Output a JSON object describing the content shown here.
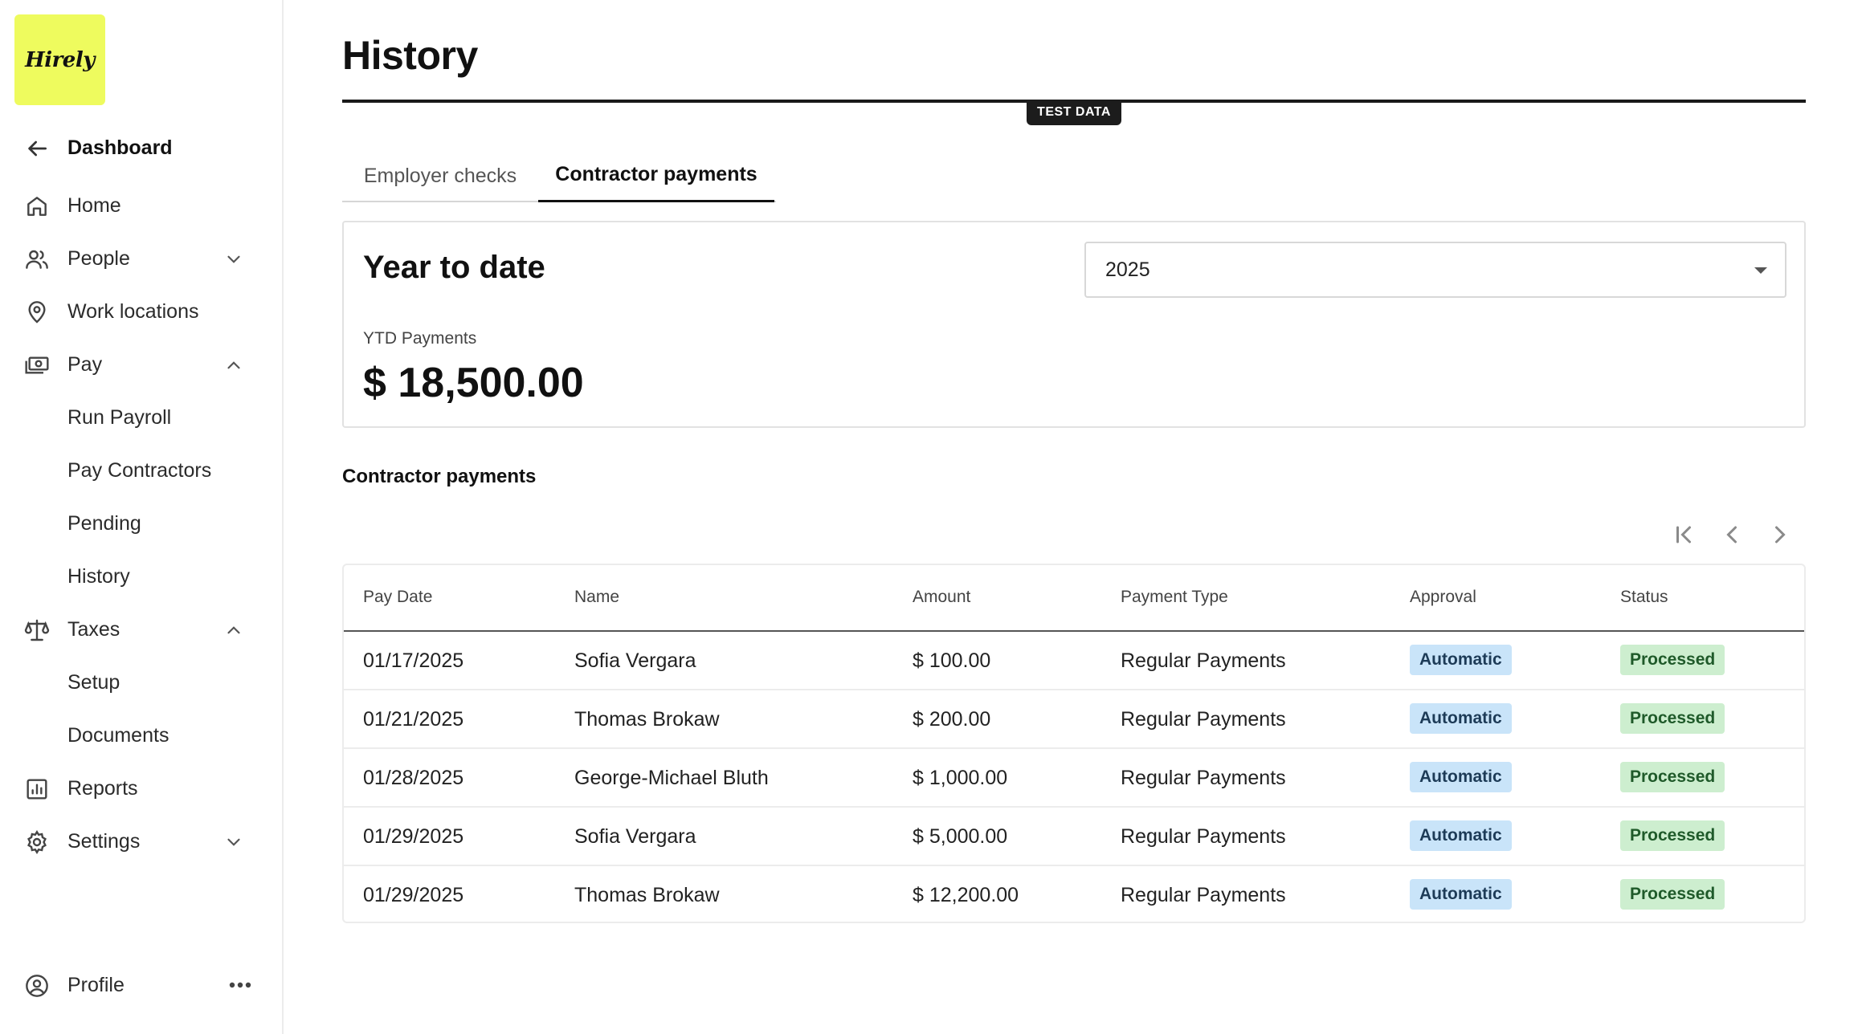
{
  "brand": {
    "logo_text": "Hirely",
    "accent": "#eefb5e"
  },
  "sidebar": {
    "dashboard": "Dashboard",
    "items": {
      "home": "Home",
      "people": "People",
      "work_locations": "Work locations",
      "pay": "Pay",
      "run_payroll": "Run Payroll",
      "pay_contractors": "Pay Contractors",
      "pending": "Pending",
      "history": "History",
      "taxes": "Taxes",
      "setup": "Setup",
      "documents": "Documents",
      "reports": "Reports",
      "settings": "Settings"
    },
    "profile": "Profile"
  },
  "page": {
    "title": "History",
    "test_badge": "TEST DATA",
    "tabs": {
      "employer": "Employer checks",
      "contractor": "Contractor payments"
    },
    "ytd": {
      "heading": "Year to date",
      "year": "2025",
      "label": "YTD Payments",
      "amount": "$ 18,500.00"
    },
    "section_title": "Contractor payments",
    "table": {
      "headers": [
        "Pay Date",
        "Name",
        "Amount",
        "Payment Type",
        "Approval",
        "Status"
      ],
      "rows": [
        [
          "01/17/2025",
          "Sofia Vergara",
          "$ 100.00",
          "Regular Payments",
          "Automatic",
          "Processed"
        ],
        [
          "01/21/2025",
          "Thomas Brokaw",
          "$ 200.00",
          "Regular Payments",
          "Automatic",
          "Processed"
        ],
        [
          "01/28/2025",
          "George-Michael Bluth",
          "$ 1,000.00",
          "Regular Payments",
          "Automatic",
          "Processed"
        ],
        [
          "01/29/2025",
          "Sofia Vergara",
          "$ 5,000.00",
          "Regular Payments",
          "Automatic",
          "Processed"
        ],
        [
          "01/29/2025",
          "Thomas Brokaw",
          "$ 12,200.00",
          "Regular Payments",
          "Automatic",
          "Processed"
        ]
      ]
    }
  },
  "icons": {
    "back": "arrow-left-icon",
    "home": "home-icon",
    "people": "people-icon",
    "location": "map-pin-icon",
    "pay": "money-icon",
    "taxes": "scale-icon",
    "reports": "chart-icon",
    "settings": "gear-icon",
    "profile": "user-circle-icon"
  }
}
